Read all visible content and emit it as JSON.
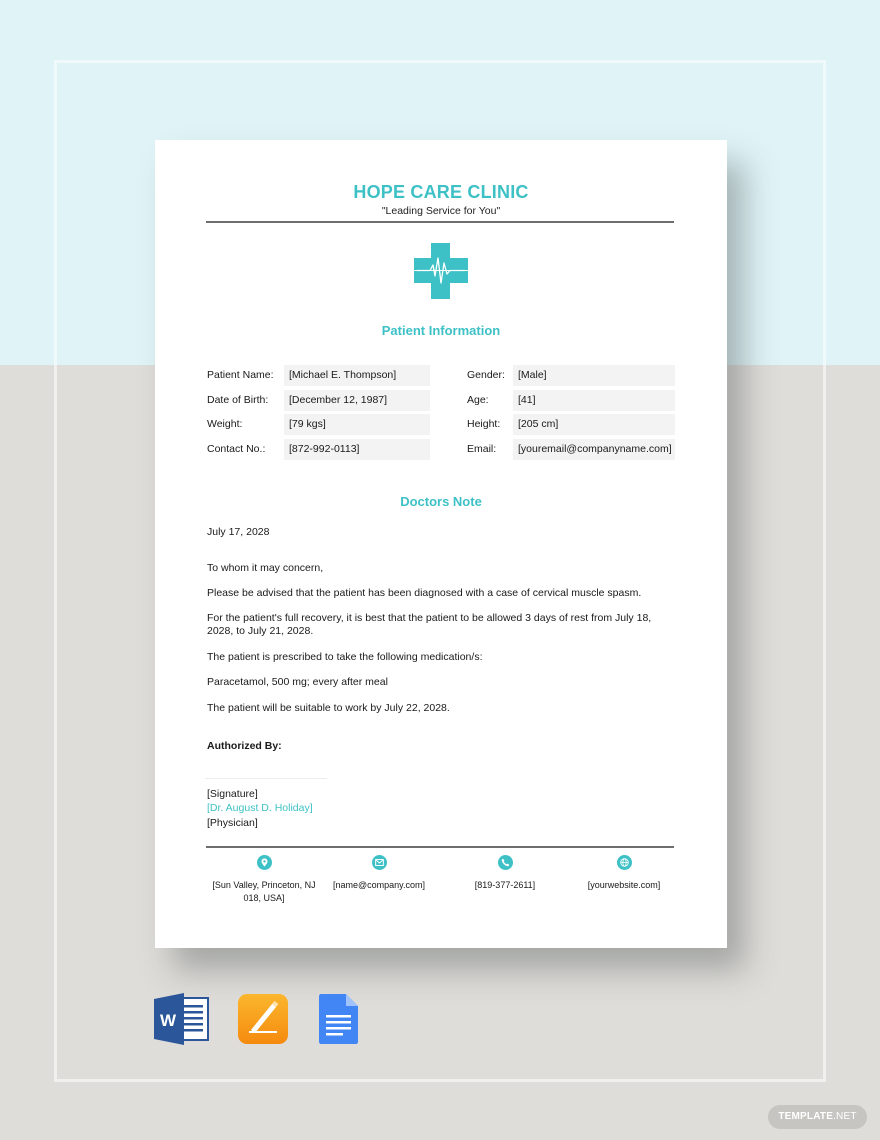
{
  "clinic": {
    "name": "HOPE CARE CLINIC",
    "tagline": "\"Leading Service for You\""
  },
  "patient_info": {
    "title": "Patient Information",
    "left": [
      {
        "label": "Patient Name:",
        "value": "[Michael E. Thompson]"
      },
      {
        "label": "Date of Birth:",
        "value": "[December 12, 1987]"
      },
      {
        "label": "Weight:",
        "value": "[79 kgs]"
      },
      {
        "label": "Contact No.:",
        "value": "[872-992-0113]"
      }
    ],
    "right": [
      {
        "label": "Gender:",
        "value": "[Male]"
      },
      {
        "label": "Age:",
        "value": "[41]"
      },
      {
        "label": "Height:",
        "value": "[205 cm]"
      },
      {
        "label": "Email:",
        "value": "[youremail@companyname.com]"
      }
    ]
  },
  "doctors_note": {
    "title": "Doctors Note",
    "date": "July 17, 2028",
    "salutation": "To whom it may concern,",
    "paragraphs": [
      "Please be advised that the patient has been diagnosed with a case of cervical muscle spasm.",
      "For the patient's full recovery, it is best that the patient to be allowed 3 days of rest from July 18, 2028, to July 21, 2028.",
      "The patient is prescribed to take the following medication/s:",
      "Paracetamol, 500 mg; every after meal",
      "The patient will be suitable to work by July 22, 2028."
    ],
    "authorized_label": "Authorized By:",
    "signature": "[Signature]",
    "doctor_name": "[Dr. August D. Holiday]",
    "doctor_title": "[Physician]"
  },
  "footer": [
    {
      "icon": "location-pin-icon",
      "text": "[Sun Valley, Princeton, NJ 018, USA]"
    },
    {
      "icon": "email-icon",
      "text": "[name@company.com]"
    },
    {
      "icon": "phone-icon",
      "text": "[819-377-2611]"
    },
    {
      "icon": "globe-icon",
      "text": "[yourwebsite.com]"
    }
  ],
  "app_icons": [
    {
      "name": "microsoft-word-icon",
      "letter": "W",
      "color": "#2b579a"
    },
    {
      "name": "apple-pages-icon",
      "color": "#f7a21b"
    },
    {
      "name": "google-docs-icon",
      "color": "#4285f4"
    }
  ],
  "watermark": {
    "bold": "TEMPLATE",
    "thin": ".NET"
  },
  "colors": {
    "accent": "#3ec1c6",
    "background_top": "#e0f4f7",
    "background_bottom": "#dfddd9"
  }
}
